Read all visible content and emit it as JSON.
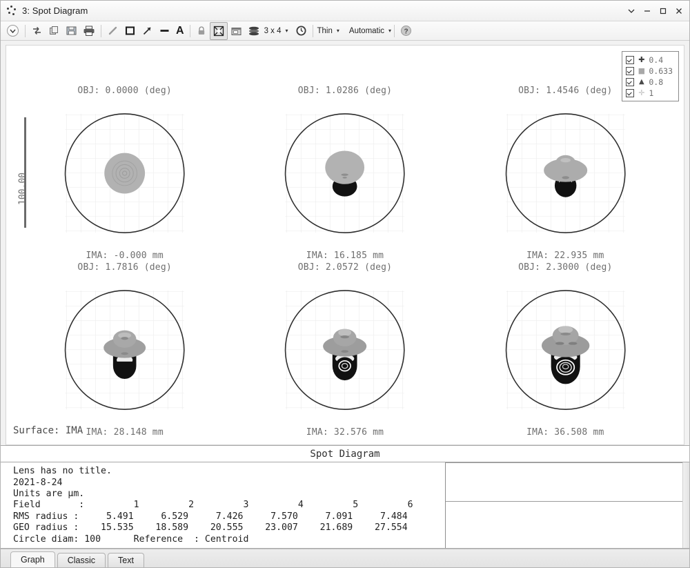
{
  "window": {
    "title": "3: Spot Diagram",
    "icon": "spot-diagram-icon",
    "controls": {
      "dropdown": "▾",
      "minimize": "–",
      "maximize": "□",
      "close": "✕"
    }
  },
  "toolbar": {
    "items": [
      {
        "name": "settings-dropdown-icon",
        "glyph": "⌄",
        "kind": "circle"
      },
      {
        "name": "refresh-icon",
        "glyph": "⇄",
        "kind": "icon"
      },
      {
        "name": "copy-icon",
        "glyph": "❐",
        "kind": "icon"
      },
      {
        "name": "save-icon",
        "glyph": "💾",
        "kind": "icon"
      },
      {
        "name": "print-icon",
        "glyph": "🖶",
        "kind": "icon"
      },
      {
        "name": "line-tool-icon",
        "glyph": "/",
        "kind": "icon"
      },
      {
        "name": "rectangle-tool-icon",
        "glyph": "□",
        "kind": "icon"
      },
      {
        "name": "arrow-tool-icon",
        "glyph": "↗",
        "kind": "icon"
      },
      {
        "name": "solid-line-tool-icon",
        "glyph": "—",
        "kind": "icon"
      },
      {
        "name": "text-tool-icon",
        "glyph": "A",
        "kind": "icon"
      },
      {
        "name": "lock-icon",
        "glyph": "⌾",
        "kind": "icon"
      },
      {
        "name": "fit-window-icon",
        "glyph": "⛶",
        "kind": "framed"
      },
      {
        "name": "detach-window-icon",
        "glyph": "▤",
        "kind": "icon"
      },
      {
        "name": "layers-icon",
        "glyph": "☰",
        "kind": "icon"
      }
    ],
    "grid_label": "3 x 4",
    "grid_caret": "▾",
    "clock_icon": "clock-icon",
    "line_weight": "Thin",
    "line_weight_caret": "▾",
    "color_mode": "Automatic",
    "color_mode_caret": "▾",
    "help_icon": "help-icon",
    "help_glyph": "?"
  },
  "legend": {
    "entries": [
      {
        "checked": true,
        "marker": "✚",
        "marker_name": "cross-marker",
        "label": "0.4",
        "color": "#3d3d3d"
      },
      {
        "checked": true,
        "marker": "■",
        "marker_name": "square-marker",
        "label": "0.633",
        "color": "#a8a8a8"
      },
      {
        "checked": true,
        "marker": "▲",
        "marker_name": "triangle-marker",
        "label": "0.8",
        "color": "#4a4a4a"
      },
      {
        "checked": true,
        "marker": "✛",
        "marker_name": "plus-marker",
        "label": "1",
        "color": "#b4b4b4"
      }
    ]
  },
  "chart_data": {
    "type": "scatter",
    "title": "Spot Diagram",
    "surface": "Surface: IMA",
    "scale_bar": "100.00",
    "circle_diameter_um": 100,
    "reference": "Centroid",
    "wavelengths_um": [
      0.4,
      0.633,
      0.8,
      1
    ],
    "grid": true,
    "legend_position": "top-right",
    "panels": [
      {
        "field": 1,
        "obj": "OBJ: 0.0000 (deg)",
        "ima": "IMA: -0.000 mm",
        "obj_deg": 0.0,
        "ima_mm": -0.0,
        "rms_radius": 5.491,
        "geo_radius": 15.535
      },
      {
        "field": 2,
        "obj": "OBJ: 1.0286 (deg)",
        "ima": "IMA: 16.185 mm",
        "obj_deg": 1.0286,
        "ima_mm": 16.185,
        "rms_radius": 6.529,
        "geo_radius": 18.589
      },
      {
        "field": 3,
        "obj": "OBJ: 1.4546 (deg)",
        "ima": "IMA: 22.935 mm",
        "obj_deg": 1.4546,
        "ima_mm": 22.935,
        "rms_radius": 7.426,
        "geo_radius": 20.555
      },
      {
        "field": 4,
        "obj": "OBJ: 1.7816 (deg)",
        "ima": "IMA: 28.148 mm",
        "obj_deg": 1.7816,
        "ima_mm": 28.148,
        "rms_radius": 7.57,
        "geo_radius": 23.007
      },
      {
        "field": 5,
        "obj": "OBJ: 2.0572 (deg)",
        "ima": "IMA: 32.576 mm",
        "obj_deg": 2.0572,
        "ima_mm": 32.576,
        "rms_radius": 7.091,
        "geo_radius": 21.689
      },
      {
        "field": 6,
        "obj": "OBJ: 2.3000 (deg)",
        "ima": "IMA: 36.508 mm",
        "obj_deg": 2.3,
        "ima_mm": 36.508,
        "rms_radius": 7.484,
        "geo_radius": 27.554
      }
    ],
    "table": {
      "rows": [
        {
          "label": "Field       :",
          "values": [
            "1",
            "2",
            "3",
            "4",
            "5",
            "6"
          ]
        },
        {
          "label": "RMS radius :",
          "values": [
            "5.491",
            "6.529",
            "7.426",
            "7.570",
            "7.091",
            "7.484"
          ]
        },
        {
          "label": "GEO radius :",
          "values": [
            "15.535",
            "18.589",
            "20.555",
            "23.007",
            "21.689",
            "27.554"
          ]
        }
      ]
    }
  },
  "panels": {
    "p1": {
      "title": "OBJ: 0.0000 (deg)",
      "foot": "IMA: -0.000 mm"
    },
    "p2": {
      "title": "OBJ: 1.0286 (deg)",
      "foot": "IMA: 16.185 mm"
    },
    "p3": {
      "title": "OBJ: 1.4546 (deg)",
      "foot": "IMA: 22.935 mm"
    },
    "p4": {
      "title": "OBJ: 1.7816 (deg)",
      "foot": "IMA: 28.148 mm"
    },
    "p5": {
      "title": "OBJ: 2.0572 (deg)",
      "foot": "IMA: 32.576 mm"
    },
    "p6": {
      "title": "OBJ: 2.3000 (deg)",
      "foot": "IMA: 36.508 mm"
    }
  },
  "scale": {
    "label": "100.00"
  },
  "surface": {
    "label": "Surface: IMA"
  },
  "report": {
    "heading": "Spot Diagram",
    "lines": [
      "Lens has no title.",
      "2021-8-24",
      "Units are µm.",
      "Field       :         1         2         3         4         5         6",
      "RMS radius :     5.491     6.529     7.426     7.570     7.091     7.484",
      "GEO radius :    15.535    18.589    20.555    23.007    21.689    27.554",
      "Circle diam: 100      Reference  : Centroid"
    ],
    "text": "Lens has no title.\n2021-8-24\nUnits are µm.\nField       :         1         2         3         4         5         6\nRMS radius :     5.491     6.529     7.426     7.570     7.091     7.484\nGEO radius :    15.535    18.589    20.555    23.007    21.689    27.554\nCircle diam: 100      Reference  : Centroid"
  },
  "tabs": [
    {
      "label": "Graph",
      "active": true
    },
    {
      "label": "Classic",
      "active": false
    },
    {
      "label": "Text",
      "active": false
    }
  ]
}
